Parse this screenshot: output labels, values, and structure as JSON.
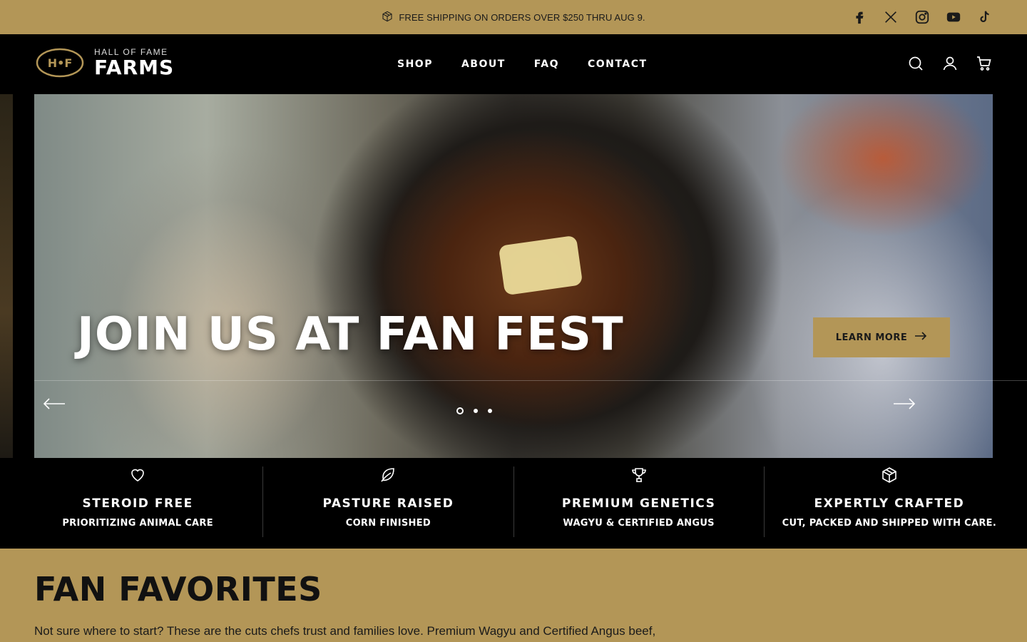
{
  "announcement": {
    "text": "FREE SHIPPING ON ORDERS OVER $250 THRU AUG 9.",
    "icon": "box-icon"
  },
  "socials": [
    {
      "name": "facebook-icon"
    },
    {
      "name": "x-icon"
    },
    {
      "name": "instagram-icon"
    },
    {
      "name": "youtube-icon"
    },
    {
      "name": "tiktok-icon"
    }
  ],
  "header": {
    "logo_small": "HALL OF FAME",
    "logo_big": "FARMS",
    "logo_mark": "H•F",
    "nav": [
      "SHOP",
      "ABOUT",
      "FAQ",
      "CONTACT"
    ],
    "icons": [
      "search-icon",
      "account-icon",
      "cart-icon"
    ]
  },
  "hero": {
    "title": "JOIN US AT FAN FEST",
    "cta_label": "LEARN MORE",
    "slide_count": 3,
    "active_slide": 1
  },
  "features": [
    {
      "icon": "heart-icon",
      "title": "STEROID FREE",
      "subtitle": "PRIORITIZING ANIMAL CARE"
    },
    {
      "icon": "leaf-icon",
      "title": "PASTURE RAISED",
      "subtitle": "CORN FINISHED"
    },
    {
      "icon": "trophy-icon",
      "title": "PREMIUM GENETICS",
      "subtitle": "WAGYU & CERTIFIED ANGUS"
    },
    {
      "icon": "box-icon",
      "title": "EXPERTLY CRAFTED",
      "subtitle": "CUT, PACKED AND SHIPPED WITH CARE."
    }
  ],
  "favorites": {
    "title": "FAN FAVORITES",
    "description": "Not sure where to start? These are the cuts chefs trust and families love. Premium Wagyu and Certified Angus beef,"
  },
  "colors": {
    "gold": "#b39657",
    "black": "#000000",
    "white": "#ffffff"
  }
}
